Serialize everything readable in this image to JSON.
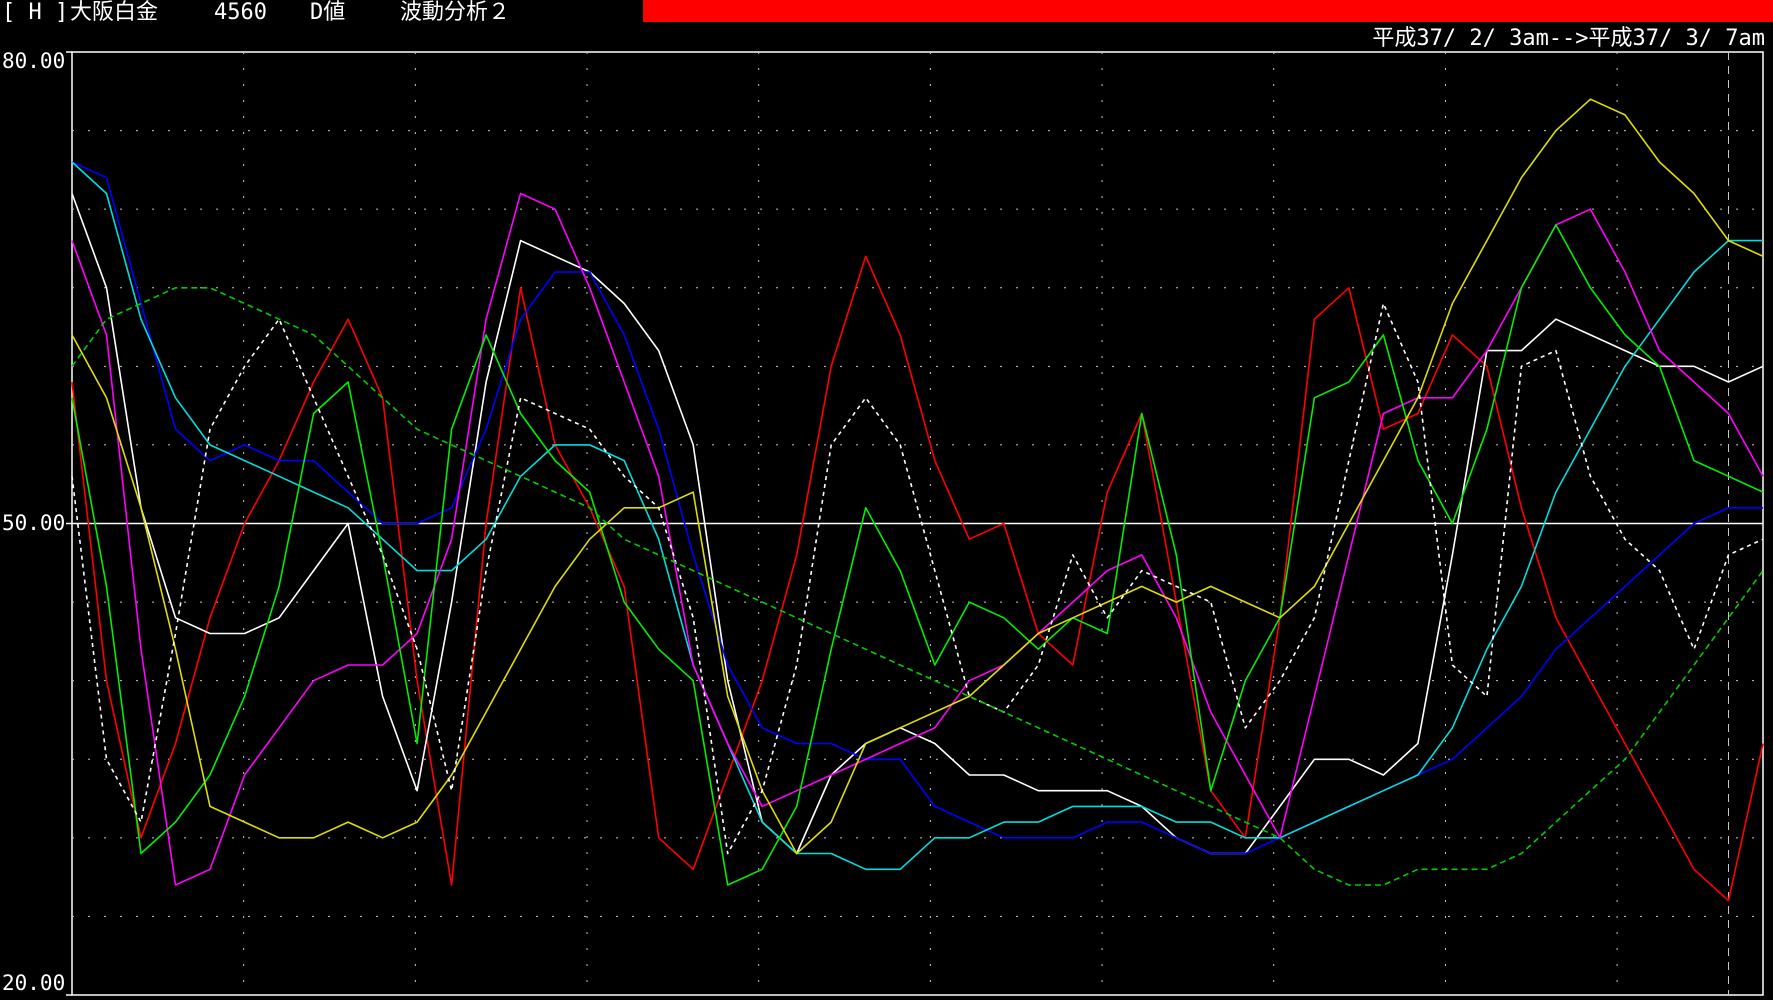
{
  "header": {
    "bracket": "[ H ]",
    "instrument": "大阪白金",
    "code": "4560",
    "value_type": "D値",
    "indicator": "波動分析２",
    "date_range": "平成37/ 2/ 3am-->平成37/ 3/ 7am"
  },
  "colors": {
    "background": "#000000",
    "header_bar": "#ff0000",
    "axis": "#ffffff",
    "grid": "#c8c8c8"
  },
  "chart_data": {
    "type": "line",
    "ylim": [
      20,
      80
    ],
    "yticks": [
      "80.00",
      "50.00",
      "20.00"
    ],
    "reference_line": 50,
    "grid": true,
    "x_count": 50,
    "series": [
      {
        "color": "#ff0000",
        "style": "solid",
        "values": [
          59,
          40,
          30,
          36,
          44,
          50,
          54,
          59,
          63,
          58,
          40,
          27,
          50,
          65,
          55,
          51,
          46,
          30,
          28,
          34,
          40,
          48,
          60,
          67,
          62,
          54,
          49,
          50,
          43,
          41,
          52,
          57,
          45,
          33,
          30,
          44,
          63,
          65,
          56,
          57,
          62,
          60,
          51,
          44,
          40,
          36,
          32,
          28,
          26,
          36
        ]
      },
      {
        "color": "#ffffff",
        "style": "solid",
        "values": [
          71,
          65,
          51,
          44,
          43,
          43,
          44,
          47,
          50,
          39,
          33,
          45,
          59,
          68,
          67,
          66,
          64,
          61,
          55,
          40,
          31,
          29,
          34,
          36,
          37,
          36,
          34,
          34,
          33,
          33,
          33,
          32,
          30,
          29,
          29,
          32,
          35,
          35,
          34,
          36,
          48,
          61,
          61,
          63,
          62,
          61,
          60,
          60,
          59,
          60
        ]
      },
      {
        "color": "#0000ff",
        "style": "solid",
        "values": [
          73,
          72,
          64,
          56,
          54,
          55,
          54,
          54,
          52,
          50,
          50,
          51,
          56,
          63,
          66,
          66,
          62,
          56,
          48,
          41,
          37,
          36,
          36,
          35,
          35,
          32,
          31,
          30,
          30,
          30,
          31,
          31,
          30,
          29,
          29,
          30,
          31,
          32,
          33,
          34,
          35,
          37,
          39,
          42,
          44,
          46,
          48,
          50,
          51,
          51
        ]
      },
      {
        "color": "#00dddd",
        "style": "solid",
        "values": [
          73,
          71,
          63,
          58,
          55,
          54,
          53,
          52,
          51,
          49,
          47,
          47,
          49,
          53,
          55,
          55,
          54,
          49,
          41,
          36,
          31,
          29,
          29,
          28,
          28,
          30,
          30,
          31,
          31,
          32,
          32,
          32,
          31,
          31,
          30,
          30,
          31,
          32,
          33,
          34,
          37,
          42,
          46,
          52,
          56,
          60,
          63,
          66,
          68,
          68
        ]
      },
      {
        "color": "#ff00ff",
        "style": "solid",
        "values": [
          68,
          62,
          42,
          27,
          28,
          34,
          37,
          40,
          41,
          41,
          43,
          49,
          63,
          71,
          70,
          65,
          59,
          53,
          41,
          36,
          32,
          33,
          34,
          35,
          36,
          37,
          40,
          41,
          43,
          45,
          47,
          48,
          44,
          38,
          34,
          30,
          39,
          48,
          57,
          58,
          58,
          61,
          65,
          69,
          70,
          66,
          61,
          59,
          57,
          53
        ]
      },
      {
        "color": "#00ee00",
        "style": "solid",
        "values": [
          58,
          46,
          29,
          31,
          34,
          39,
          46,
          57,
          59,
          48,
          36,
          56,
          62,
          57,
          54,
          52,
          45,
          42,
          40,
          27,
          28,
          32,
          42,
          51,
          47,
          41,
          45,
          44,
          42,
          44,
          43,
          57,
          48,
          33,
          40,
          44,
          58,
          59,
          62,
          54,
          50,
          56,
          65,
          69,
          65,
          62,
          60,
          54,
          53,
          52
        ]
      },
      {
        "color": "#dddd00",
        "style": "solid",
        "values": [
          62,
          58,
          51,
          42,
          32,
          31,
          30,
          30,
          31,
          30,
          31,
          34,
          38,
          42,
          46,
          49,
          51,
          51,
          52,
          39,
          33,
          29,
          31,
          36,
          37,
          38,
          39,
          41,
          43,
          44,
          45,
          46,
          45,
          46,
          45,
          44,
          46,
          50,
          54,
          58,
          64,
          68,
          72,
          75,
          77,
          76,
          73,
          71,
          68,
          67
        ]
      },
      {
        "color": "#ffffff",
        "style": "dotted",
        "values": [
          53,
          35,
          31,
          43,
          56,
          60,
          63,
          58,
          53,
          48,
          42,
          33,
          47,
          58,
          57,
          56,
          53,
          51,
          44,
          29,
          33,
          41,
          55,
          58,
          55,
          47,
          39,
          38,
          41,
          48,
          44,
          47,
          46,
          45,
          37,
          40,
          44,
          54,
          64,
          59,
          41,
          39,
          60,
          61,
          53,
          49,
          47,
          42,
          48,
          49
        ]
      },
      {
        "color": "#00cc00",
        "style": "dashed",
        "values": [
          60,
          63,
          64,
          65,
          65,
          64,
          63,
          62,
          60,
          58,
          56,
          55,
          54,
          53,
          52,
          51,
          49,
          48,
          47,
          46,
          45,
          44,
          43,
          42,
          41,
          40,
          39,
          38,
          37,
          36,
          35,
          34,
          33,
          32,
          31,
          30,
          28,
          27,
          27,
          28,
          28,
          28,
          29,
          31,
          33,
          35,
          38,
          41,
          44,
          47
        ]
      }
    ]
  }
}
